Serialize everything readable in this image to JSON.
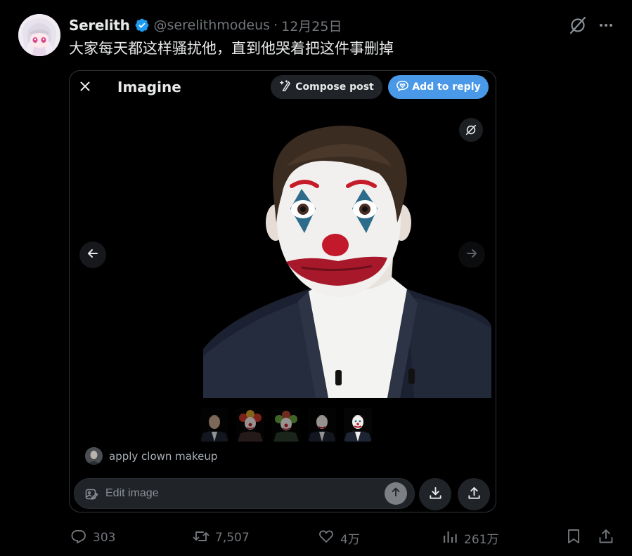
{
  "tweet": {
    "name": "Serelith",
    "handle": "@serelithmodeus",
    "separator": "·",
    "date": "12月25日",
    "text": "大家每天都这样骚扰他，直到他哭着把这件事删掉"
  },
  "card": {
    "title": "Imagine",
    "compose_label": "Compose post",
    "reply_label": "Add to reply",
    "prompt": "apply clown makeup",
    "edit_placeholder": "Edit image"
  },
  "stats": {
    "replies": "303",
    "reposts": "7,507",
    "likes": "4万",
    "views": "261万"
  },
  "icons": {
    "verified": "verified-badge-icon",
    "grok": "grok-icon",
    "more": "more-icon",
    "close": "close-icon",
    "compose": "sparkle-pen-icon",
    "reply": "heart-chat-icon",
    "prev": "arrow-left-icon",
    "next": "arrow-right-icon",
    "send": "arrow-up-icon",
    "download": "download-icon",
    "share": "share-icon",
    "bookmark": "bookmark-icon",
    "analytics": "analytics-icon"
  },
  "colors": {
    "background": "#000000",
    "text": "#e7e9ea",
    "muted": "#71767b",
    "accent": "#4a99e9",
    "verified": "#1d9bf0"
  }
}
